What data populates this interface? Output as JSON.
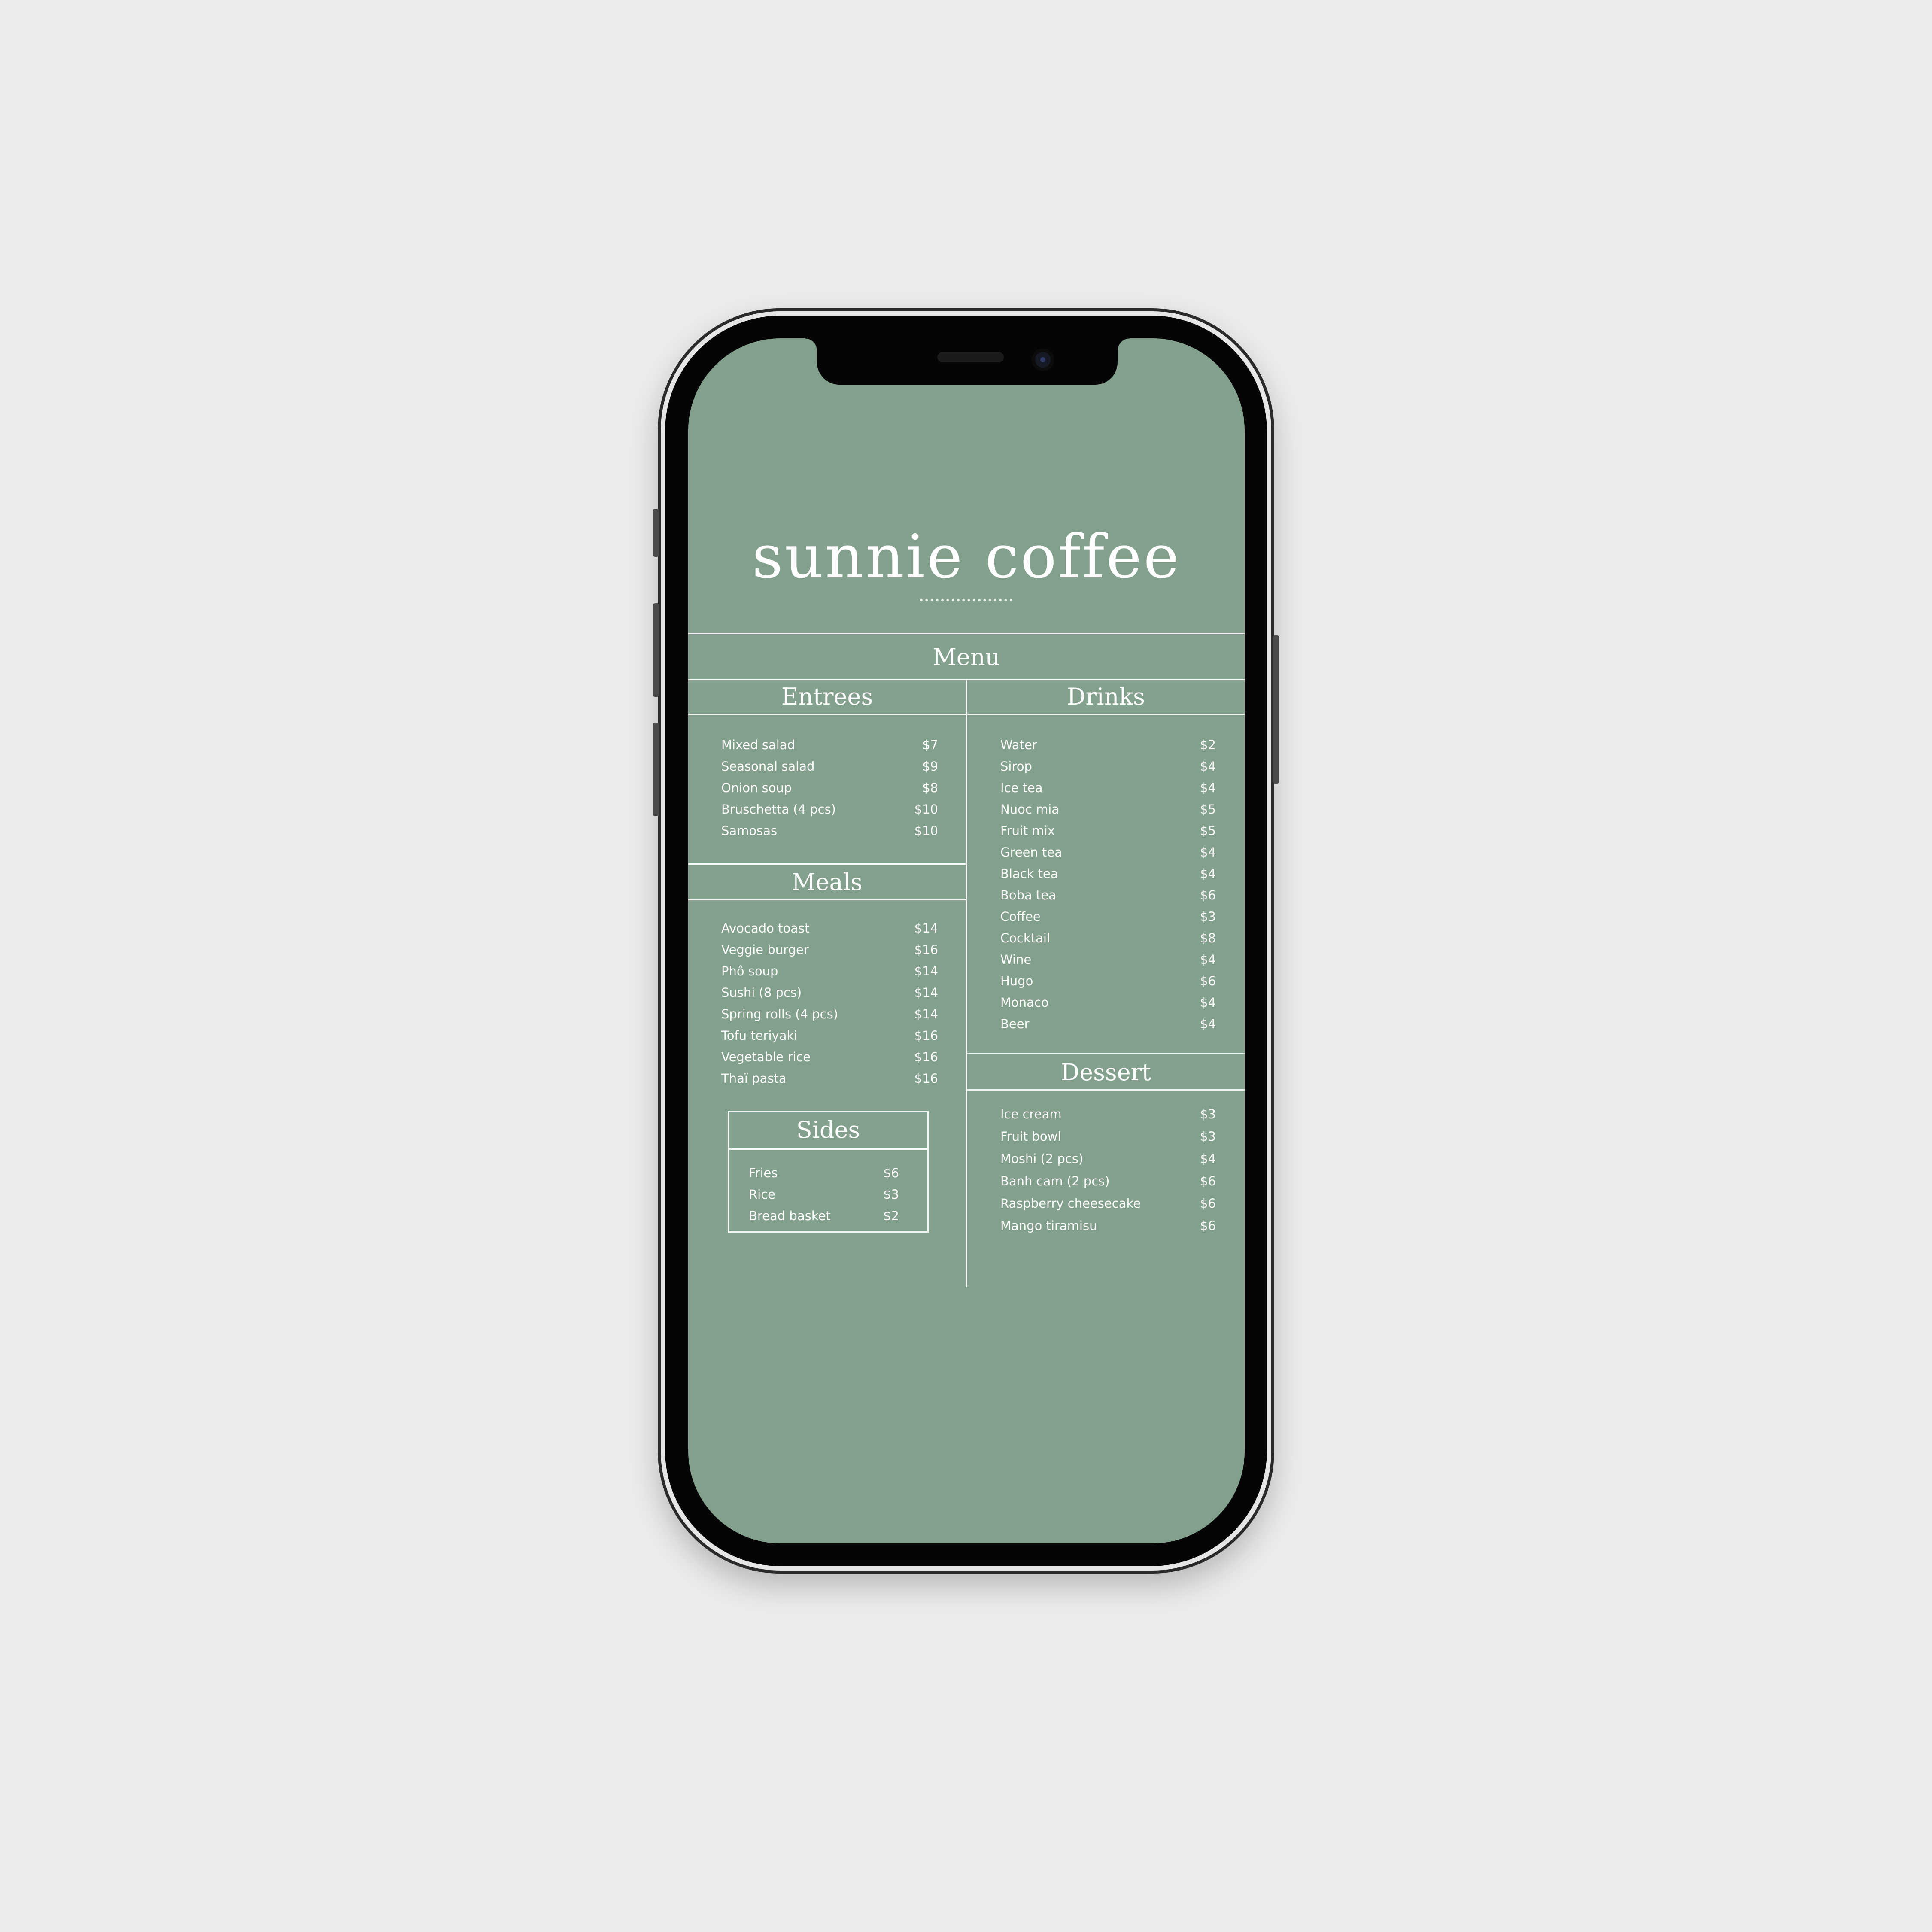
{
  "brand": "sunnie coffee",
  "menu_title": "Menu",
  "sections": {
    "entrees": {
      "title": "Entrees",
      "items": [
        {
          "name": "Mixed salad",
          "price": "$7"
        },
        {
          "name": "Seasonal salad",
          "price": "$9"
        },
        {
          "name": "Onion soup",
          "price": "$8"
        },
        {
          "name": "Bruschetta (4 pcs)",
          "price": "$10"
        },
        {
          "name": "Samosas",
          "price": "$10"
        }
      ]
    },
    "meals": {
      "title": "Meals",
      "items": [
        {
          "name": "Avocado toast",
          "price": "$14"
        },
        {
          "name": "Veggie burger",
          "price": "$16"
        },
        {
          "name": "Phô soup",
          "price": "$14"
        },
        {
          "name": "Sushi (8 pcs)",
          "price": "$14"
        },
        {
          "name": "Spring rolls (4 pcs)",
          "price": "$14"
        },
        {
          "name": "Tofu teriyaki",
          "price": "$16"
        },
        {
          "name": "Vegetable rice",
          "price": "$16"
        },
        {
          "name": "Thaï pasta",
          "price": "$16"
        }
      ]
    },
    "sides": {
      "title": "Sides",
      "items": [
        {
          "name": "Fries",
          "price": "$6"
        },
        {
          "name": "Rice",
          "price": "$3"
        },
        {
          "name": "Bread basket",
          "price": "$2"
        }
      ]
    },
    "drinks": {
      "title": "Drinks",
      "items": [
        {
          "name": "Water",
          "price": "$2"
        },
        {
          "name": "Sirop",
          "price": "$4"
        },
        {
          "name": "Ice tea",
          "price": "$4"
        },
        {
          "name": "Nuoc mia",
          "price": "$5"
        },
        {
          "name": "Fruit mix",
          "price": "$5"
        },
        {
          "name": "Green tea",
          "price": "$4"
        },
        {
          "name": "Black tea",
          "price": "$4"
        },
        {
          "name": "Boba tea",
          "price": "$6"
        },
        {
          "name": "Coffee",
          "price": "$3"
        },
        {
          "name": "Cocktail",
          "price": "$8"
        },
        {
          "name": "Wine",
          "price": "$4"
        },
        {
          "name": "Hugo",
          "price": "$6"
        },
        {
          "name": "Monaco",
          "price": "$4"
        },
        {
          "name": "Beer",
          "price": "$4"
        }
      ]
    },
    "dessert": {
      "title": "Dessert",
      "items": [
        {
          "name": "Ice cream",
          "price": "$3"
        },
        {
          "name": "Fruit bowl",
          "price": "$3"
        },
        {
          "name": "Moshi (2 pcs)",
          "price": "$4"
        },
        {
          "name": "Banh cam (2 pcs)",
          "price": "$6"
        },
        {
          "name": "Raspberry cheesecake",
          "price": "$6"
        },
        {
          "name": "Mango tiramisu",
          "price": "$6"
        }
      ]
    }
  },
  "colors": {
    "background": "#ececec",
    "screen": "#83a08d",
    "text": "#ffffff"
  }
}
